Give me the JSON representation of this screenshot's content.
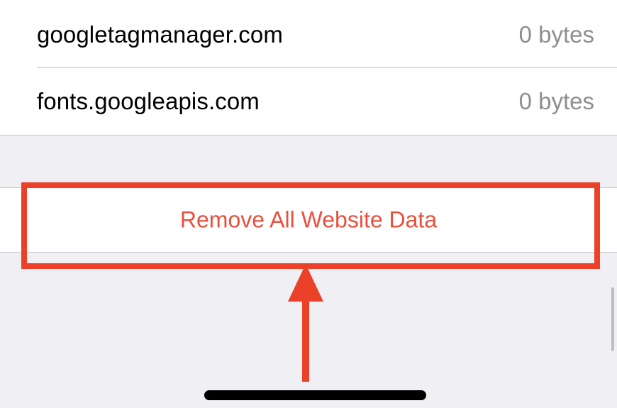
{
  "website_data": {
    "rows": [
      {
        "site": "googletagmanager.com",
        "size": "0 bytes"
      },
      {
        "site": "fonts.googleapis.com",
        "size": "0 bytes"
      }
    ]
  },
  "remove_all": {
    "label": "Remove All Website Data",
    "color": "#e8503e"
  },
  "annotation": {
    "highlight_color": "#ea4128",
    "arrow_color": "#ea4128",
    "arrow_icon": "arrow-up-icon"
  }
}
